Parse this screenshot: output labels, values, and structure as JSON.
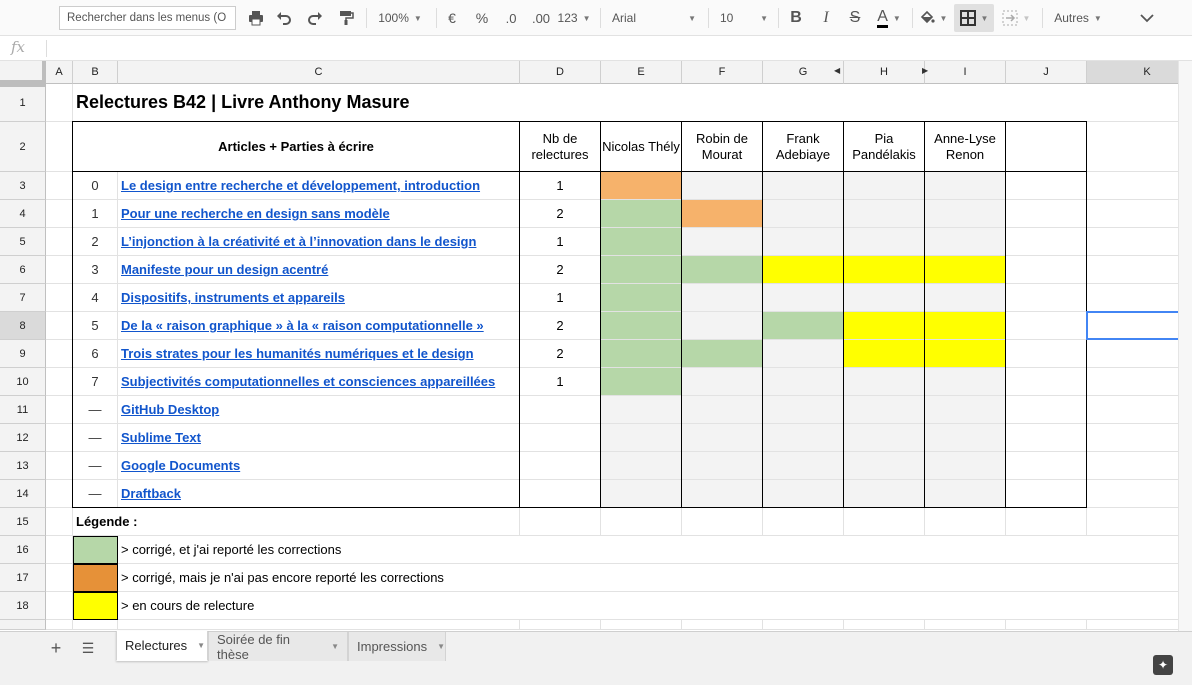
{
  "toolbar": {
    "search_placeholder": "Rechercher dans les menus (O",
    "zoom": "100%",
    "currency": "€",
    "percent": "%",
    "dec_less": ".0",
    "dec_more": ".00",
    "format_123": "123",
    "font": "Arial",
    "font_size": "10",
    "bold": "B",
    "italic": "I",
    "strike": "S",
    "text_color": "A",
    "more": "Autres"
  },
  "formula_bar": {
    "fx": "fx",
    "value": ""
  },
  "columns": [
    "A",
    "B",
    "C",
    "D",
    "E",
    "F",
    "G",
    "H",
    "I",
    "J",
    "K"
  ],
  "rows": [
    "1",
    "2",
    "3",
    "4",
    "5",
    "6",
    "7",
    "8",
    "9",
    "10",
    "11",
    "12",
    "13",
    "14",
    "15",
    "16",
    "17",
    "18"
  ],
  "sheet": {
    "title": "Relectures B42 | Livre Anthony Masure",
    "header": {
      "articles": "Articles + Parties à écrire",
      "count": "Nb de relectures",
      "reviewers": [
        "Nicolas Thély",
        "Robin de Mourat",
        "Frank Adebiaye",
        "Pia Pandélakis",
        "Anne-Lyse Renon"
      ]
    },
    "articles": [
      {
        "num": "0",
        "title": "Le design entre recherche et développement, introduction",
        "count": "1",
        "status": [
          "orange",
          "grey",
          "grey",
          "grey",
          "grey"
        ]
      },
      {
        "num": "1",
        "title": "Pour une recherche en design sans modèle",
        "count": "2",
        "status": [
          "green",
          "orange",
          "grey",
          "grey",
          "grey"
        ]
      },
      {
        "num": "2",
        "title": "L’injonction à la créativité et à l’innovation dans le design",
        "count": "1",
        "status": [
          "green",
          "grey",
          "grey",
          "grey",
          "grey"
        ]
      },
      {
        "num": "3",
        "title": "Manifeste pour un design acentré",
        "count": "2",
        "status": [
          "green",
          "green",
          "yellow",
          "yellow",
          "yellow"
        ]
      },
      {
        "num": "4",
        "title": "Dispositifs, instruments et appareils",
        "count": "1",
        "status": [
          "green",
          "grey",
          "grey",
          "grey",
          "grey"
        ]
      },
      {
        "num": "5",
        "title": "De la « raison graphique » à la « raison computationnelle »",
        "count": "2",
        "status": [
          "green",
          "grey",
          "green",
          "yellow",
          "yellow"
        ]
      },
      {
        "num": "6",
        "title": "Trois strates pour les humanités numériques et le design",
        "count": "2",
        "status": [
          "green",
          "green",
          "grey",
          "yellow",
          "yellow"
        ]
      },
      {
        "num": "7",
        "title": "Subjectivités computationnelles et consciences appareillées",
        "count": "1",
        "status": [
          "green",
          "grey",
          "grey",
          "grey",
          "grey"
        ]
      },
      {
        "num": "—",
        "title": "GitHub Desktop",
        "count": "",
        "status": [
          "grey",
          "grey",
          "grey",
          "grey",
          "grey"
        ]
      },
      {
        "num": "—",
        "title": "Sublime Text",
        "count": "",
        "status": [
          "grey",
          "grey",
          "grey",
          "grey",
          "grey"
        ]
      },
      {
        "num": "—",
        "title": "Google Documents",
        "count": "",
        "status": [
          "grey",
          "grey",
          "grey",
          "grey",
          "grey"
        ]
      },
      {
        "num": "—",
        "title": "Draftback",
        "count": "",
        "status": [
          "grey",
          "grey",
          "grey",
          "grey",
          "grey"
        ]
      }
    ],
    "legend": {
      "title": "Légende :",
      "items": [
        {
          "color": "#b6d7a8",
          "label": "> corrigé, et j'ai reporté les corrections"
        },
        {
          "color": "#e69138",
          "label": "> corrigé, mais je n'ai pas encore reporté les corrections"
        },
        {
          "color": "#ffff00",
          "label": "> en cours de relecture"
        }
      ]
    }
  },
  "colors": {
    "green": "#b6d7a8",
    "orange": "#f6b26b",
    "yellow": "#ffff00",
    "grey": "#f3f3f3",
    "link": "#1155cc",
    "selection": "#4285f4"
  },
  "tabs": [
    {
      "label": "Relectures",
      "active": true
    },
    {
      "label": "Soirée de fin thèse",
      "active": false
    },
    {
      "label": "Impressions",
      "active": false
    }
  ]
}
